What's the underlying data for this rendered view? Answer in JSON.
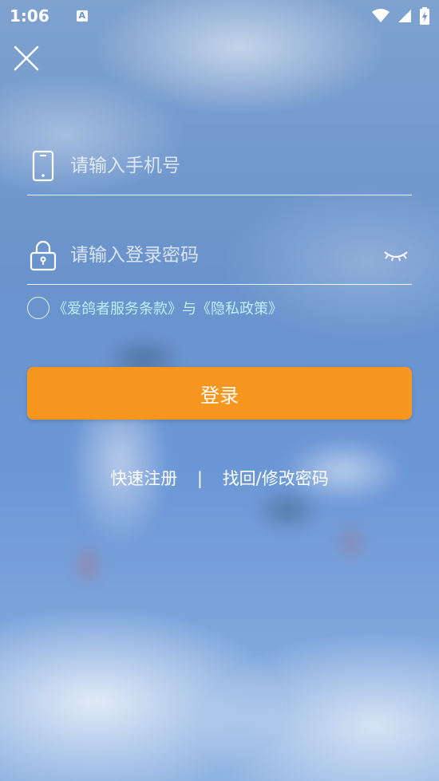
{
  "status_bar": {
    "time": "1:06",
    "notification_icon": "a-icon",
    "icons": [
      "wifi-icon",
      "signal-icon",
      "battery-charging-icon"
    ]
  },
  "login": {
    "close_icon": "close-icon",
    "phone_placeholder": "请输入手机号",
    "password_placeholder": "请输入登录密码",
    "agreement_terms": "《爱鸽者服务条款》",
    "agreement_and": "与",
    "agreement_privacy": "《隐私政策》",
    "login_button": "登录",
    "register_link": "快速注册",
    "separator": "|",
    "recover_link": "找回/修改密码"
  },
  "colors": {
    "accent": "#f7961f",
    "link_text": "#c9f0f6"
  }
}
